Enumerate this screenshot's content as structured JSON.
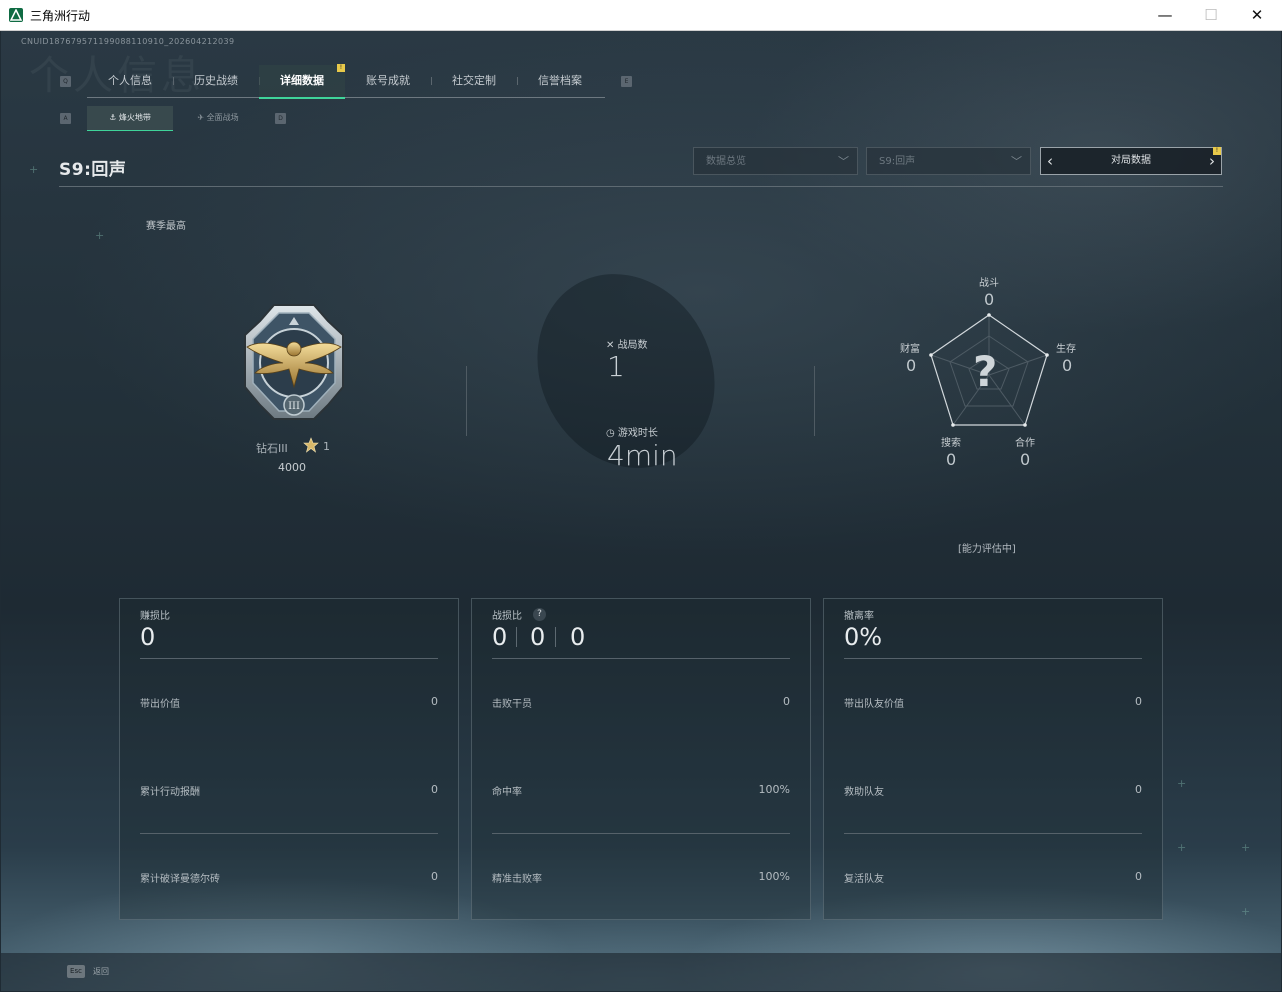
{
  "window": {
    "title": "三角洲行动",
    "minimize": "—",
    "maximize": "☐",
    "close": "✕"
  },
  "uid": "CNUID18767957119908811091­0_202604212039",
  "tabs": {
    "left_key": "Q",
    "right_key": "E",
    "items": [
      "个人信息",
      "历史战绩",
      "详细数据",
      "账号成就",
      "社交定制",
      "信誉档案"
    ],
    "active": "详细数据",
    "notify": "!"
  },
  "subtabs": {
    "left_key": "A",
    "right_key": "D",
    "items": [
      "烽火地带",
      "全面战场"
    ],
    "active": "烽火地带"
  },
  "season": {
    "title": "S9:回声",
    "dropdown_1": "数据总览",
    "dropdown_2": "S9:回声",
    "pager_label": "对局数据",
    "pager_notify": "!"
  },
  "rank": {
    "section_label": "赛季最高",
    "name": "钻石III",
    "stars": "1",
    "score": "4000"
  },
  "matches": {
    "label": "战局数",
    "value": "1"
  },
  "playtime": {
    "label": "游戏时长",
    "value": "4min"
  },
  "radar": {
    "combat": {
      "label": "战斗",
      "value": "0"
    },
    "survival": {
      "label": "生存",
      "value": "0"
    },
    "cooperation": {
      "label": "合作",
      "value": "0"
    },
    "search": {
      "label": "搜索",
      "value": "0"
    },
    "wealth": {
      "label": "财富",
      "value": "0"
    },
    "center_mark": "?",
    "assessment": "[能力评估中]"
  },
  "panels": [
    {
      "label": "赚损比",
      "value": "0",
      "rows": [
        {
          "k": "带出价值",
          "v": "0"
        },
        {
          "k": "累计行动报酬",
          "v": "0"
        },
        {
          "k": "累计破译曼德尔砖",
          "v": "0"
        }
      ]
    },
    {
      "label": "战损比",
      "help": "?",
      "values": [
        "0",
        "0",
        "0"
      ],
      "rows": [
        {
          "k": "击败干员",
          "v": "0"
        },
        {
          "k": "命中率",
          "v": "100%"
        },
        {
          "k": "精准击败率",
          "v": "100%"
        }
      ]
    },
    {
      "label": "撤离率",
      "value": "0%",
      "rows": [
        {
          "k": "带出队友价值",
          "v": "0"
        },
        {
          "k": "救助队友",
          "v": "0"
        },
        {
          "k": "复活队友",
          "v": "0"
        }
      ]
    }
  ],
  "footer": {
    "esc_key": "Esc",
    "esc_label": "返回"
  },
  "colors": {
    "accent": "#3fd49a",
    "notify": "#e8c94a",
    "background": "#1f2b34"
  }
}
